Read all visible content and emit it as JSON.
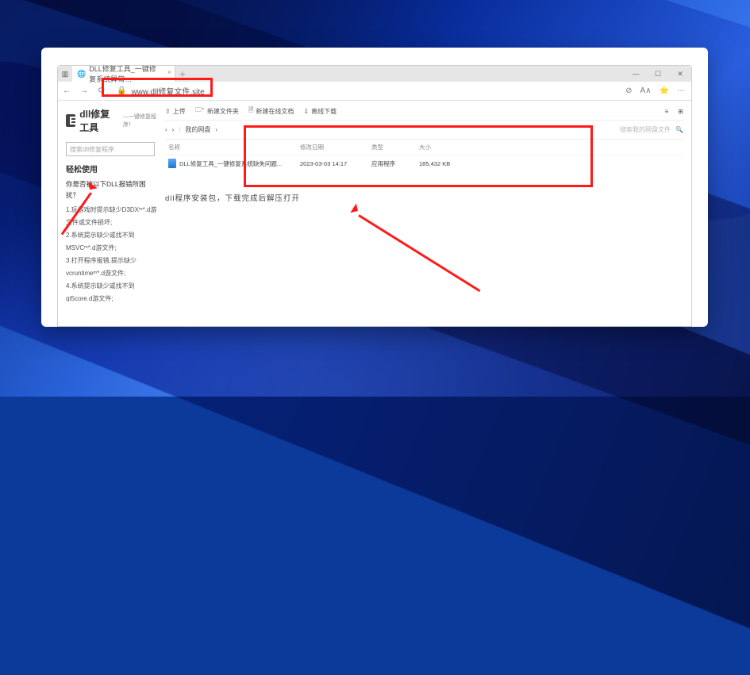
{
  "browser": {
    "tab_title": "DLL修复工具_一键修复系统异常…",
    "window": {
      "min": "—",
      "max": "☐",
      "close": "✕"
    },
    "nav": {
      "back": "←",
      "fwd": "→",
      "reload": "⟳"
    },
    "url": "www.dll修复文件.site",
    "lock_hint": "🔒",
    "right_icons": [
      "⊘",
      "A∧",
      "⭐",
      "⋯"
    ]
  },
  "site": {
    "brand_title": "dll修复工具",
    "brand_sub": "—一键修复程序！",
    "search_placeholder": "搜索dll修复程序",
    "heading": "轻松使用",
    "question": "你是否被以下DLL报错所困扰？",
    "symptoms": [
      "1.玩游戏时提示缺少D3DXᵐ*.d游文件或文件损坏;",
      "2.系统提示缺少或找不到  MSVCᵐ*.d游文件;",
      "3.打开程序报错,提示缺少  vcruntimeᵐ*.d游文件;",
      "4.系统提示缺少或找不到  qt5core.d游文件;"
    ]
  },
  "panel": {
    "toolbar": {
      "upload": "上传",
      "newfolder": "新建文件夹",
      "newonline": "新建在线文档",
      "download": "离线下载"
    },
    "view_icons": [
      "≡",
      "⊞"
    ],
    "crumb": {
      "back": "‹",
      "fwd": "›",
      "label": "我的网盘",
      "sep": "›"
    },
    "crumb_search": "搜索我的网盘文件",
    "headers": {
      "name": "名称",
      "date": "修改日期",
      "type": "类型",
      "size": "大小"
    },
    "file": {
      "name": "DLL修复工具_一键修复系统缺失问题...",
      "date": "2023-03-03 14:17",
      "type": "应用程序",
      "size": "185,432 KB"
    },
    "message": "dll程序安装包，下载完成后解压打开"
  },
  "colors": {
    "annot": "#ff1a1a"
  }
}
